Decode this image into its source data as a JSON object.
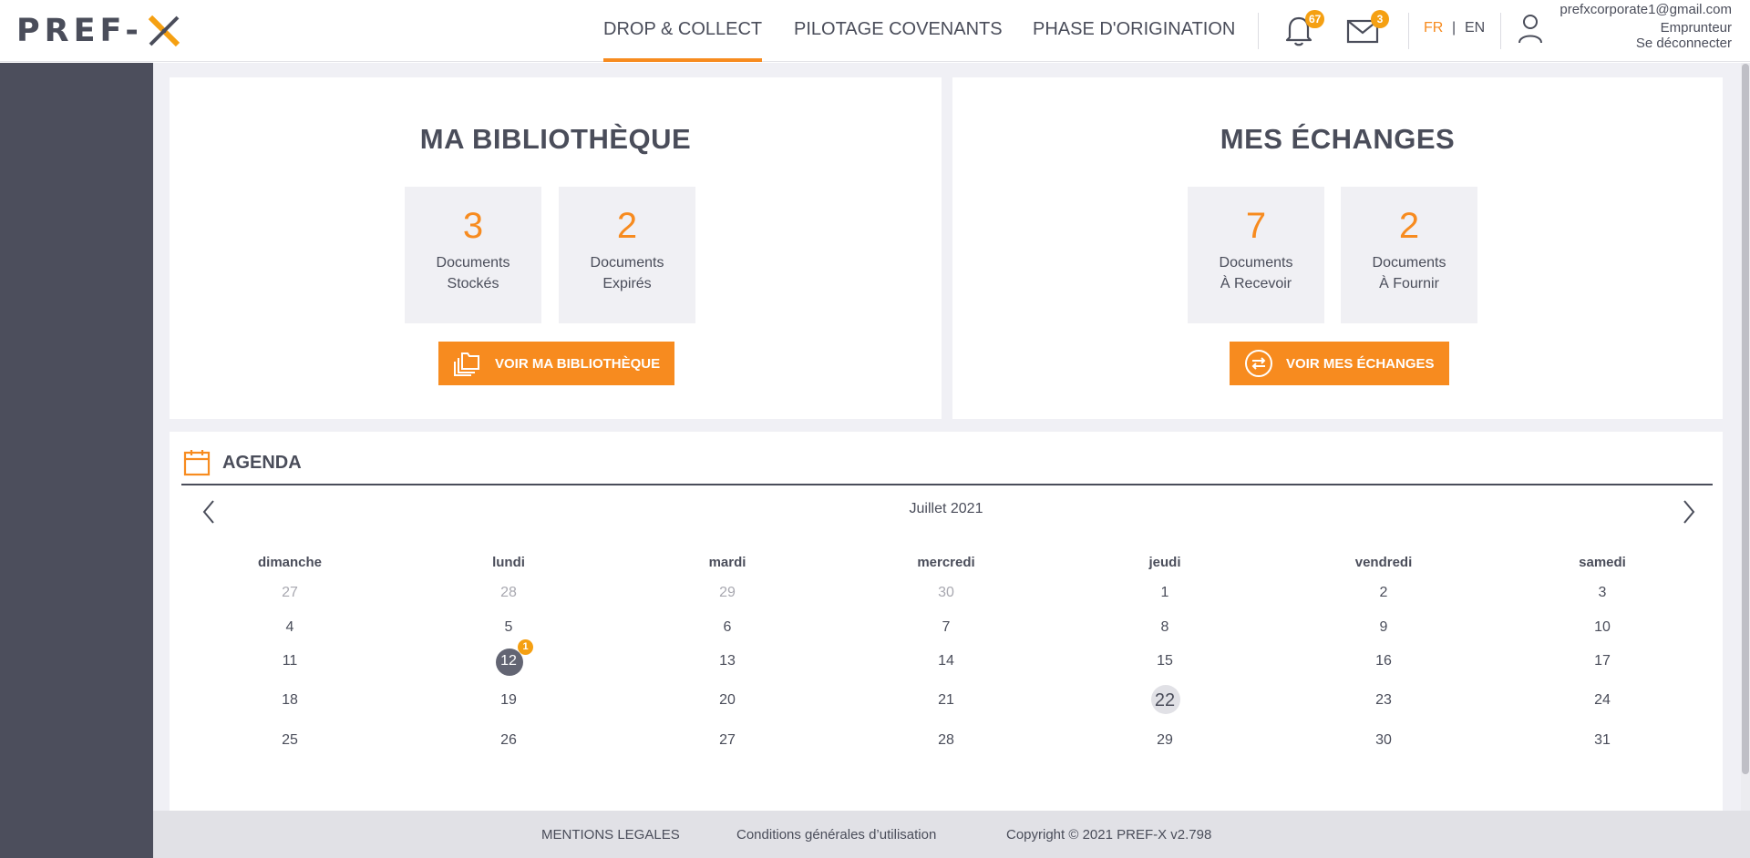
{
  "header": {
    "logo_text": "PREF-",
    "nav": [
      "DROP & COLLECT",
      "PILOTAGE COVENANTS",
      "PHASE D'ORIGINATION"
    ],
    "notifications_count": "67",
    "messages_count": "3",
    "lang_fr": "FR",
    "lang_sep": "|",
    "lang_en": "EN",
    "user_email": "prefxcorporate1@gmail.com",
    "user_role": "Emprunteur",
    "logout": "Se déconnecter"
  },
  "library": {
    "title": "MA BIBLIOTHÈQUE",
    "stats": [
      {
        "value": "3",
        "line1": "Documents",
        "line2": "Stockés"
      },
      {
        "value": "2",
        "line1": "Documents",
        "line2": "Expirés"
      }
    ],
    "button": "VOIR MA BIBLIOTHÈQUE"
  },
  "exchanges": {
    "title": "MES ÉCHANGES",
    "stats": [
      {
        "value": "7",
        "line1": "Documents",
        "line2": "À Recevoir"
      },
      {
        "value": "2",
        "line1": "Documents",
        "line2": "À Fournir"
      }
    ],
    "button": "VOIR MES ÉCHANGES"
  },
  "agenda": {
    "title": "AGENDA",
    "month": "Juillet 2021",
    "weekdays": [
      "dimanche",
      "lundi",
      "mardi",
      "mercredi",
      "jeudi",
      "vendredi",
      "samedi"
    ],
    "weeks": [
      [
        "27",
        "28",
        "29",
        "30",
        "1",
        "2",
        "3"
      ],
      [
        "4",
        "5",
        "6",
        "7",
        "8",
        "9",
        "10"
      ],
      [
        "11",
        "12",
        "13",
        "14",
        "15",
        "16",
        "17"
      ],
      [
        "18",
        "19",
        "20",
        "21",
        "22",
        "23",
        "24"
      ],
      [
        "25",
        "26",
        "27",
        "28",
        "29",
        "30",
        "31"
      ]
    ],
    "event_day": "12",
    "event_count": "1",
    "today": "22"
  },
  "footer": {
    "legal": "MENTIONS LEGALES",
    "terms": "Conditions générales d’utilisation",
    "copyright": "Copyright © 2021 PREF-X v2.798"
  },
  "colors": {
    "accent": "#f78b1f",
    "badge": "#f5a012",
    "text": "#4a4d5a",
    "sidebar": "#4c4e5c",
    "background": "#f0f0f5"
  },
  "icons": [
    "bell-icon",
    "mail-icon",
    "user-icon",
    "library-icon",
    "exchange-icon",
    "calendar-icon",
    "chevron-left-icon",
    "chevron-right-icon"
  ]
}
